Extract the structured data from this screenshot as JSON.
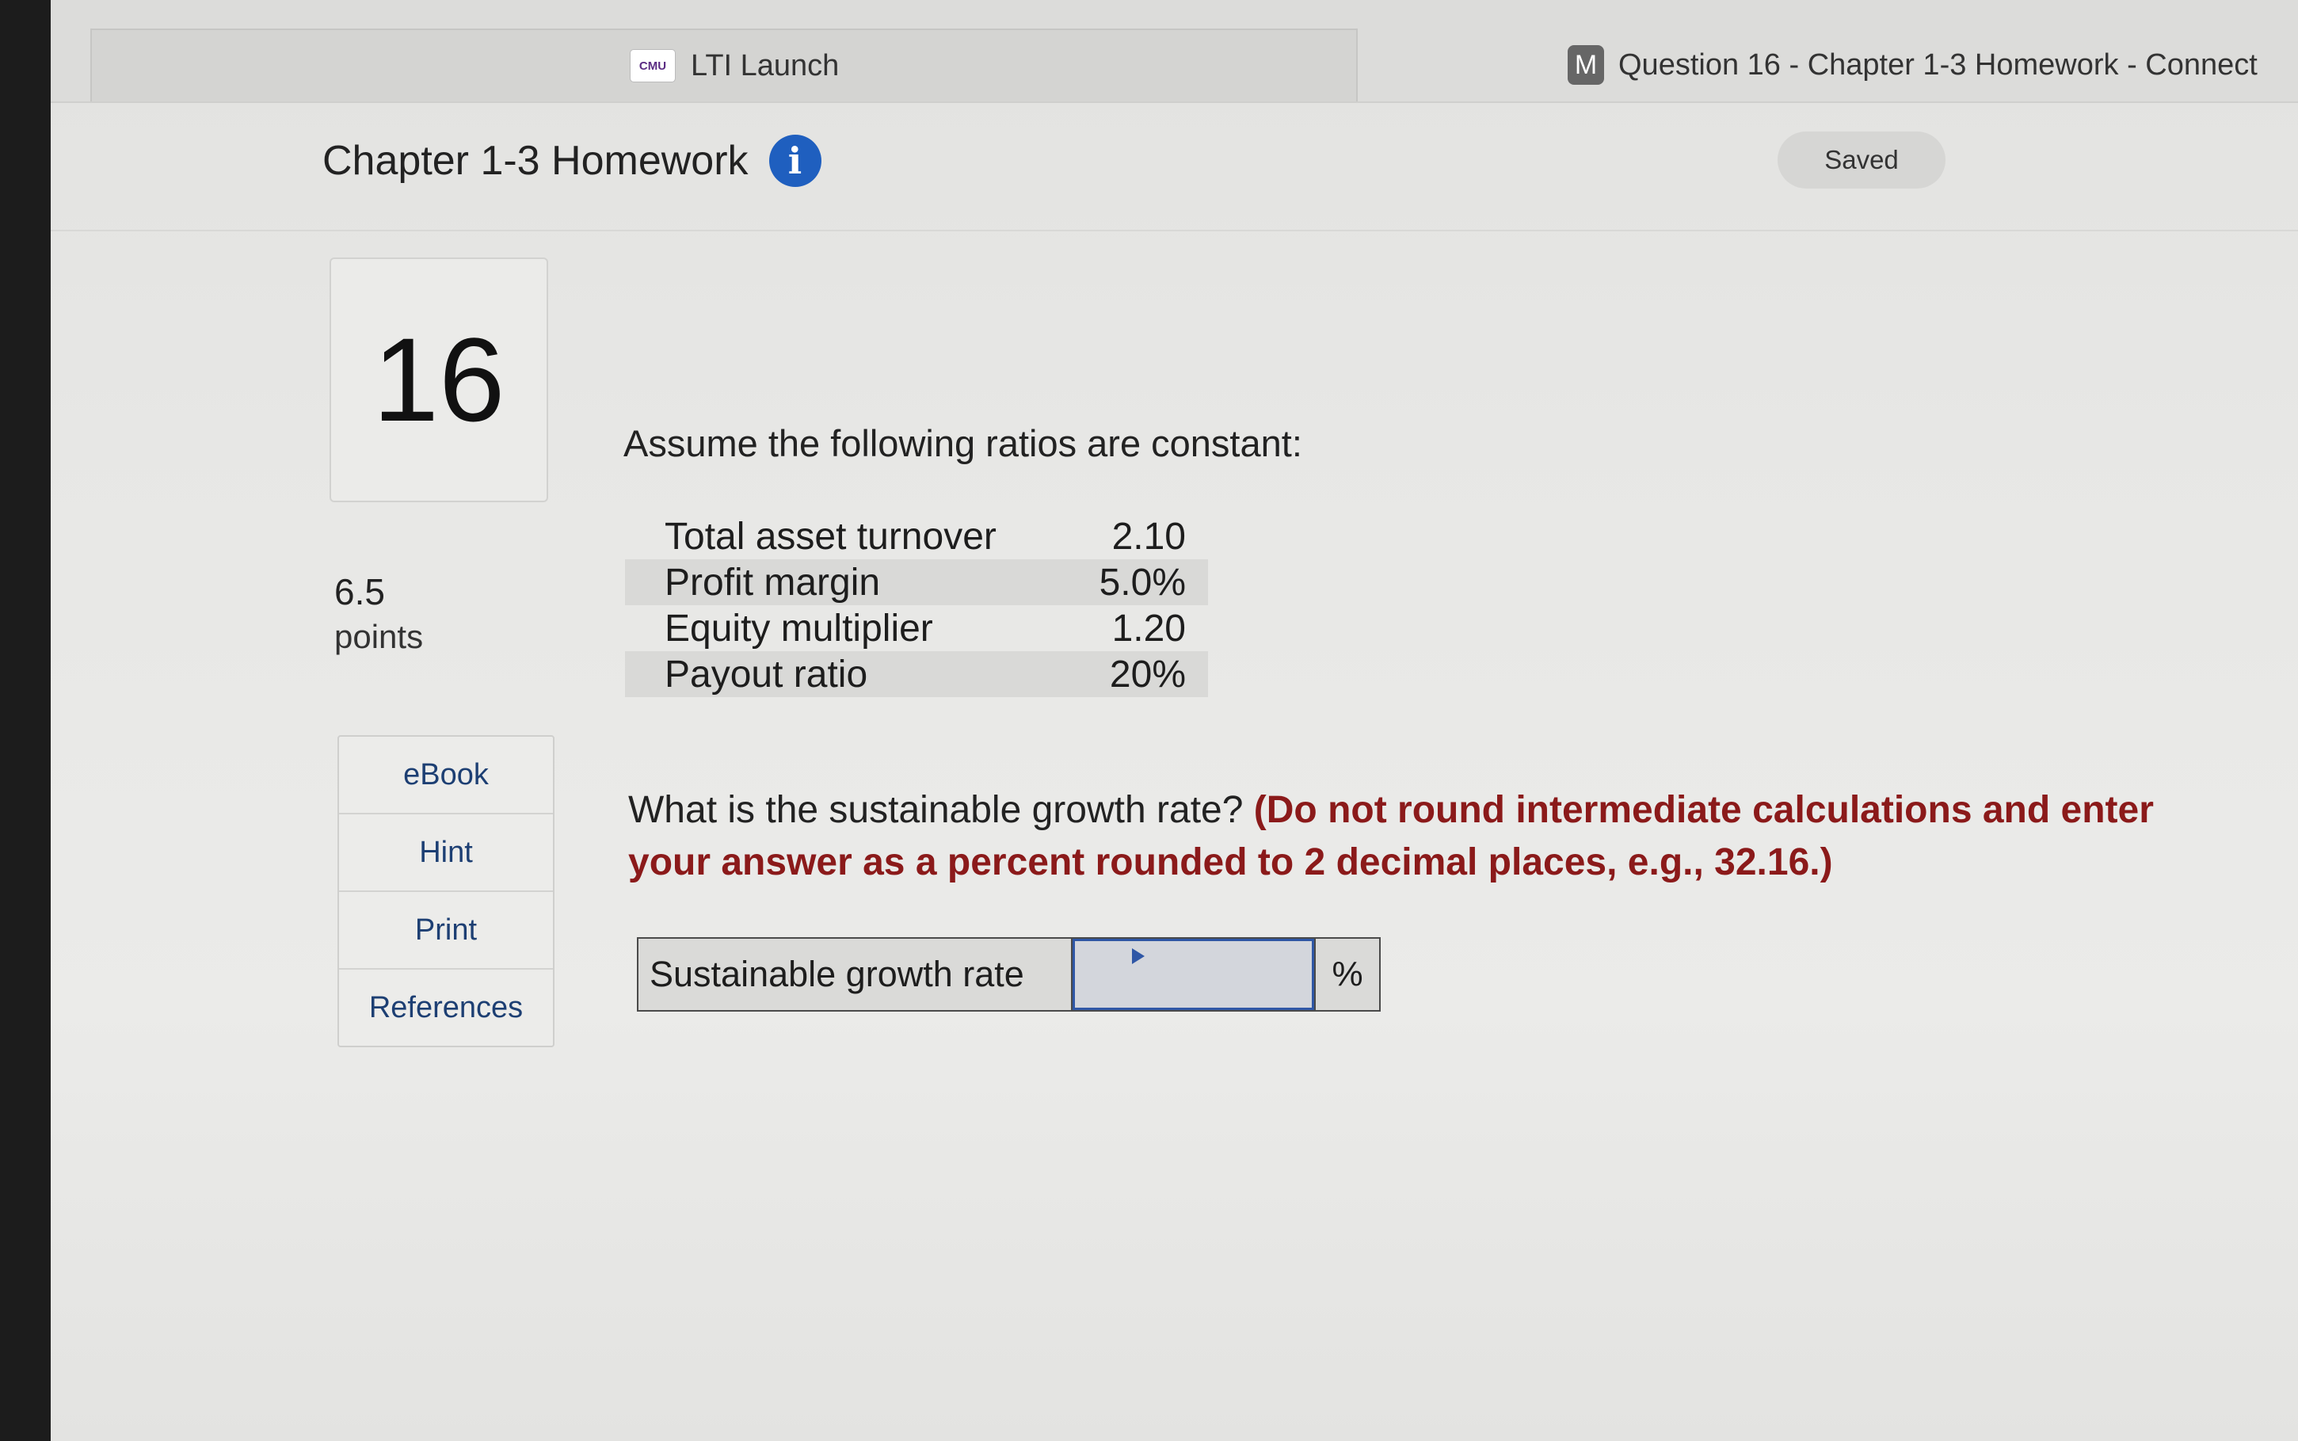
{
  "browser": {
    "active_tab": {
      "favicon_text": "CMU",
      "label": "LTI Launch"
    },
    "other_tab": {
      "favicon_text": "M",
      "label": "Question 16 - Chapter 1-3 Homework - Connect"
    }
  },
  "header": {
    "title": "Chapter 1-3 Homework",
    "info_glyph": "i",
    "status": "Saved"
  },
  "question": {
    "number": "16",
    "points_value": "6.5",
    "points_label": "points",
    "intro": "Assume the following ratios are constant:",
    "ratios": [
      {
        "label": "Total asset turnover",
        "value": "2.10"
      },
      {
        "label": "Profit margin",
        "value": "5.0%"
      },
      {
        "label": "Equity multiplier",
        "value": "1.20"
      },
      {
        "label": "Payout ratio",
        "value": "20%"
      }
    ],
    "prompt": "What is the sustainable growth rate?",
    "instruction": "(Do not round intermediate calculations and enter your answer as a percent rounded to 2 decimal places, e.g., 32.16.)",
    "answer": {
      "label": "Sustainable growth rate",
      "value": "",
      "unit": "%"
    }
  },
  "side_menu": [
    "eBook",
    "Hint",
    "Print",
    "References"
  ],
  "colors": {
    "info_icon": "#1f5fbf",
    "instruction_text": "#8b1a1a",
    "input_border": "#2f57a6"
  }
}
